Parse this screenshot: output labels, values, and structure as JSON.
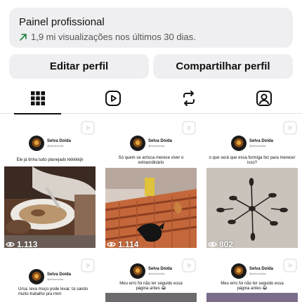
{
  "dashboard": {
    "title": "Painel profissional",
    "stat": "1,9 mi visualizações nos últimos 30 dias."
  },
  "buttons": {
    "edit": "Editar perfil",
    "share": "Compartilhar perfil"
  },
  "tabs": [
    {
      "icon": "grid-icon",
      "active": true
    },
    {
      "icon": "reels-icon",
      "active": false
    },
    {
      "icon": "reposts-icon",
      "active": false
    },
    {
      "icon": "tagged-icon",
      "active": false
    }
  ],
  "posts": [
    {
      "account": "Selva Doida",
      "handle": "@selvadoida",
      "caption": "Ele já tinha tudo planejado kkkkkkjk",
      "views": "1.113"
    },
    {
      "account": "Selva Doida",
      "handle": "@selvadoida",
      "caption": "Só quem se arrisca merece viver o extraordinário",
      "views": "1.114"
    },
    {
      "account": "Selva Doida",
      "handle": "@selvadoida",
      "caption": "o que será que essa formiga fez para merecer isso?",
      "views": "802"
    },
    {
      "account": "Selva Doida",
      "handle": "@selvadoida",
      "caption": "Ursa: leva moço pode levar, tá sando muito trabalho pra mim"
    },
    {
      "account": "Selva Doida",
      "handle": "@selvadoida",
      "caption": "Meu erro foi não ter seguido essa página antes 😂"
    },
    {
      "account": "Selva Doida",
      "handle": "@selvadoida",
      "caption": "Meu erro foi não ter seguido essa página antes 😂"
    }
  ],
  "colors": {
    "trend_up": "#1a7f37",
    "panel_bg": "#efeff1"
  }
}
